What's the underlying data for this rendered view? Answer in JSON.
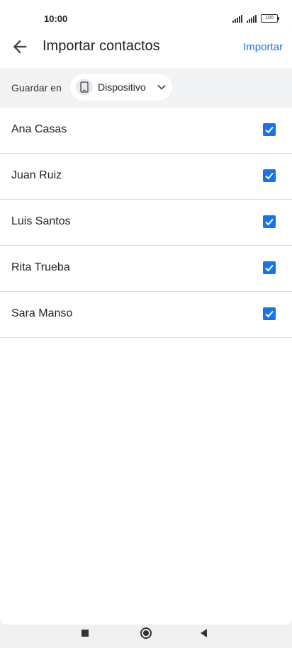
{
  "status_bar": {
    "time": "10:00",
    "battery": "100"
  },
  "app_bar": {
    "title": "Importar contactos",
    "action_label": "Importar"
  },
  "save_in": {
    "label": "Guardar en",
    "account": "Dispositivo"
  },
  "contacts": [
    {
      "name": "Ana Casas",
      "checked": true
    },
    {
      "name": "Juan Ruiz",
      "checked": true
    },
    {
      "name": "Luis Santos",
      "checked": true
    },
    {
      "name": "Rita Trueba",
      "checked": true
    },
    {
      "name": "Sara Manso",
      "checked": true
    }
  ],
  "icons": {
    "back": "arrow-back-icon",
    "device": "phone-icon",
    "dropdown": "chevron-down-icon",
    "checkbox": "check-icon"
  },
  "colors": {
    "accent": "#1a73e8",
    "save_bar": "#f1f3f4",
    "divider": "#dadce0"
  }
}
